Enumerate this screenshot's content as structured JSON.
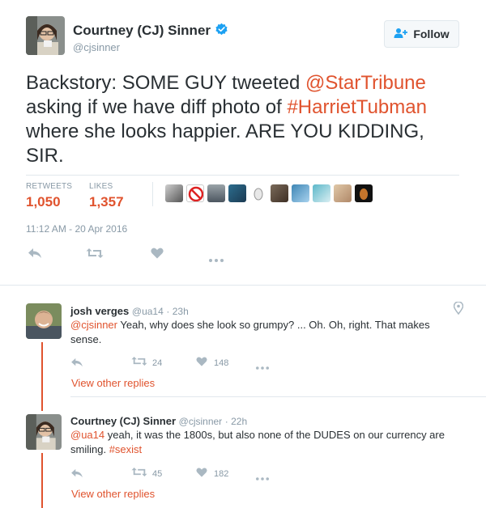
{
  "tweet": {
    "author_name": "Courtney (CJ) Sinner",
    "author_handle": "@cjsinner",
    "follow_label": "Follow",
    "text_parts": {
      "p1": "Backstory: SOME GUY tweeted ",
      "mention": "@StarTribune",
      "p2": " asking if we have diff photo of ",
      "hashtag": "#HarrietTubman",
      "p3": " where she looks happier. ARE YOU KIDDING, SIR."
    },
    "retweets_label": "RETWEETS",
    "retweets_count": "1,050",
    "likes_label": "LIKES",
    "likes_count": "1,357",
    "timestamp": "11:12 AM - 20 Apr 2016"
  },
  "replies": [
    {
      "author_name": "josh verges",
      "author_handle": "@ua14",
      "time": "· 23h",
      "mention": "@cjsinner",
      "text": " Yeah, why does she look so grumpy? ... Oh. Oh, right. That makes sense.",
      "retweets": "24",
      "likes": "148",
      "view_other": "View other replies"
    },
    {
      "author_name": "Courtney (CJ) Sinner",
      "author_handle": "@cjsinner",
      "time": "· 22h",
      "mention": "@ua14",
      "text": " yeah, it was the 1800s, but also none of the DUDES on our currency are smiling. ",
      "hashtag": "#sexist",
      "retweets": "45",
      "likes": "182",
      "view_other": "View other replies"
    }
  ],
  "colors": {
    "accent": "#e0532e",
    "verified": "#1da1f2",
    "muted": "#8899a6",
    "text": "#292f33"
  },
  "icons": [
    "verified-badge-icon",
    "follow-person-icon",
    "reply-icon",
    "retweet-icon",
    "like-icon",
    "more-icon",
    "location-pin-icon"
  ]
}
